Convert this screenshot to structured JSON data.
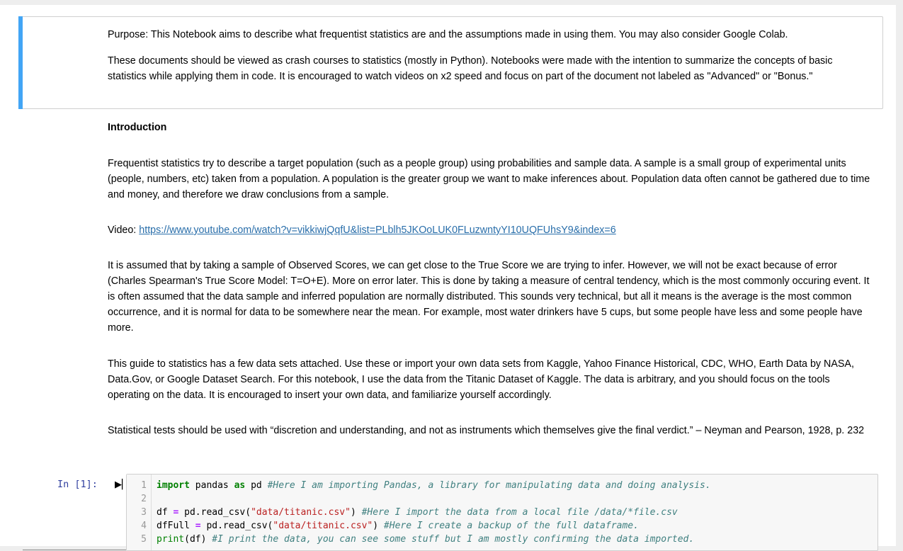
{
  "markdown": {
    "purpose": "Purpose: This Notebook aims to describe what frequentist statistics are and the assumptions made in using them. You may also consider Google Colab.",
    "crash_course": "These documents should be viewed as crash courses to statistics (mostly in Python). Notebooks were made with the intention to summarize the concepts of basic statistics while applying them in code. It is encouraged to watch videos on x2 speed and focus on part of the document not labeled as \"Advanced\" or \"Bonus.\"",
    "intro_heading": "Introduction",
    "intro_paragraph": "Frequentist statistics try to describe a target population (such as a people group) using probabilities and sample data. A sample is a small group of experimental units (people, numbers, etc) taken from a population. A population is the greater group we want to make inferences about. Population data often cannot be gathered due to time and money, and therefore we draw conclusions from a sample.",
    "video_label": "Video: ",
    "video_url": "https://www.youtube.com/watch?v=vikkiwjQqfU&list=PLblh5JKOoLUK0FLuzwntyYI10UQFUhsY9&index=6",
    "assumption_paragraph": "It is assumed that by taking a sample of Observed Scores, we can get close to the True Score we are trying to infer. However, we will not be exact because of error (Charles Spearman's True Score Model: T=O+E). More on error later. This is done by taking a measure of central tendency, which is the most commonly occuring event. It is often assumed that the data sample and inferred population are normally distributed. This sounds very technical, but all it means is the average is the most common occurrence, and it is normal for data to be somewhere near the mean. For example, most water drinkers have 5 cups, but some people have less and some people have more.",
    "datasets_paragraph": "This guide to statistics has a few data sets attached. Use these or import your own data sets from Kaggle, Yahoo Finance Historical, CDC, WHO, Earth Data by NASA, Data.Gov, or Google Dataset Search. For this notebook, I use the data from the Titanic Dataset of Kaggle. The data is arbitrary, and you should focus on the tools operating on the data. It is encouraged to insert your own data, and familiarize yourself accordingly.",
    "quote_paragraph": "Statistical tests should be used with “discretion and understanding, and not as instruments which themselves give the final verdict.” – Neyman and Pearson, 1928, p. 232"
  },
  "code_cell": {
    "prompt": "In [1]:",
    "run_icon": "run-cell-icon",
    "line_numbers": [
      "1",
      "2",
      "3",
      "4",
      "5"
    ],
    "lines": {
      "l1_kw_import": "import",
      "l1_mod": " pandas ",
      "l1_kw_as": "as",
      "l1_alias": " pd ",
      "l1_comment": "#Here I am importing Pandas, a library for manipulating data and doing analysis.",
      "l3_var": "df ",
      "l3_eq": "=",
      "l3_call": " pd.read_csv(",
      "l3_str": "\"data/titanic.csv\"",
      "l3_close": ") ",
      "l3_comment": "#Here I import the data from a local file /data/*file.csv",
      "l4_var": "dfFull ",
      "l4_eq": "=",
      "l4_call": " pd.read_csv(",
      "l4_str": "\"data/titanic.csv\"",
      "l4_close": ") ",
      "l4_comment": "#Here I create a backup of the full dataframe.",
      "l5_print": "print",
      "l5_args": "(df) ",
      "l5_comment": "#I print the data, you can see some stuff but I am mostly confirming the data imported."
    }
  },
  "colors": {
    "accent": "#42a5f5",
    "prompt": "#303f9f",
    "link": "#296eaa"
  }
}
